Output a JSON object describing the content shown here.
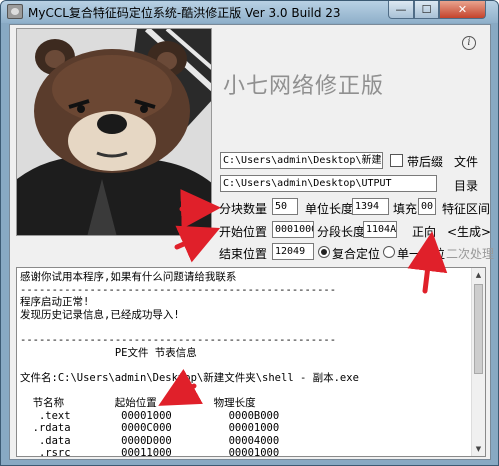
{
  "window": {
    "title": "MyCCL复合特征码定位系统-酷洪修正版  Ver 3.0  Build 23",
    "min_glyph": "—",
    "max_glyph": "☐",
    "close_glyph": "✕"
  },
  "watermark": "小七网络修正版",
  "info_glyph": "i",
  "file": {
    "path": "C:\\Users\\admin\\Desktop\\新建文",
    "suffix_label": "带后缀",
    "file_button": "文件",
    "output": "C:\\Users\\admin\\Desktop\\UTPUT",
    "dir_button": "目录"
  },
  "params": {
    "block_count_label": "分块数量",
    "block_count": "50",
    "unit_length_label": "单位长度",
    "unit_length": "1394",
    "fill_label": "填充",
    "fill": "00",
    "feature_range": "特征区间",
    "start_label": "开始位置",
    "start": "0001000",
    "segment_length_label": "分段长度",
    "segment_length": "1104A",
    "generate": "<生成>",
    "end_label": "结束位置",
    "end": "12049",
    "composite_label": "复合定位",
    "single_label": "单一定位",
    "forward": "正向",
    "secondary": "二次处理"
  },
  "console": {
    "lines": [
      "感谢你试用本程序,如果有什么问题请给我联系",
      "--------------------------------------------------",
      "程序启动正常!",
      "发现历史记录信息,已经成功导入!",
      "",
      "--------------------------------------------------",
      "               PE文件 节表信息",
      "",
      "文件名:C:\\Users\\admin\\Desktop\\新建文件夹\\shell - 副本.exe",
      "",
      "  节名称        起始位置         物理长度",
      "   .text        00001000         0000B000",
      "  .rdata        0000C000         00001000",
      "   .data        0000D000         00004000",
      "   .rsrc        00011000         00001000"
    ],
    "up_glyph": "▲",
    "down_glyph": "▼"
  },
  "colors": {
    "annotation": "#e0202a",
    "title_bar": "#9dbad2",
    "close": "#c4432b"
  }
}
